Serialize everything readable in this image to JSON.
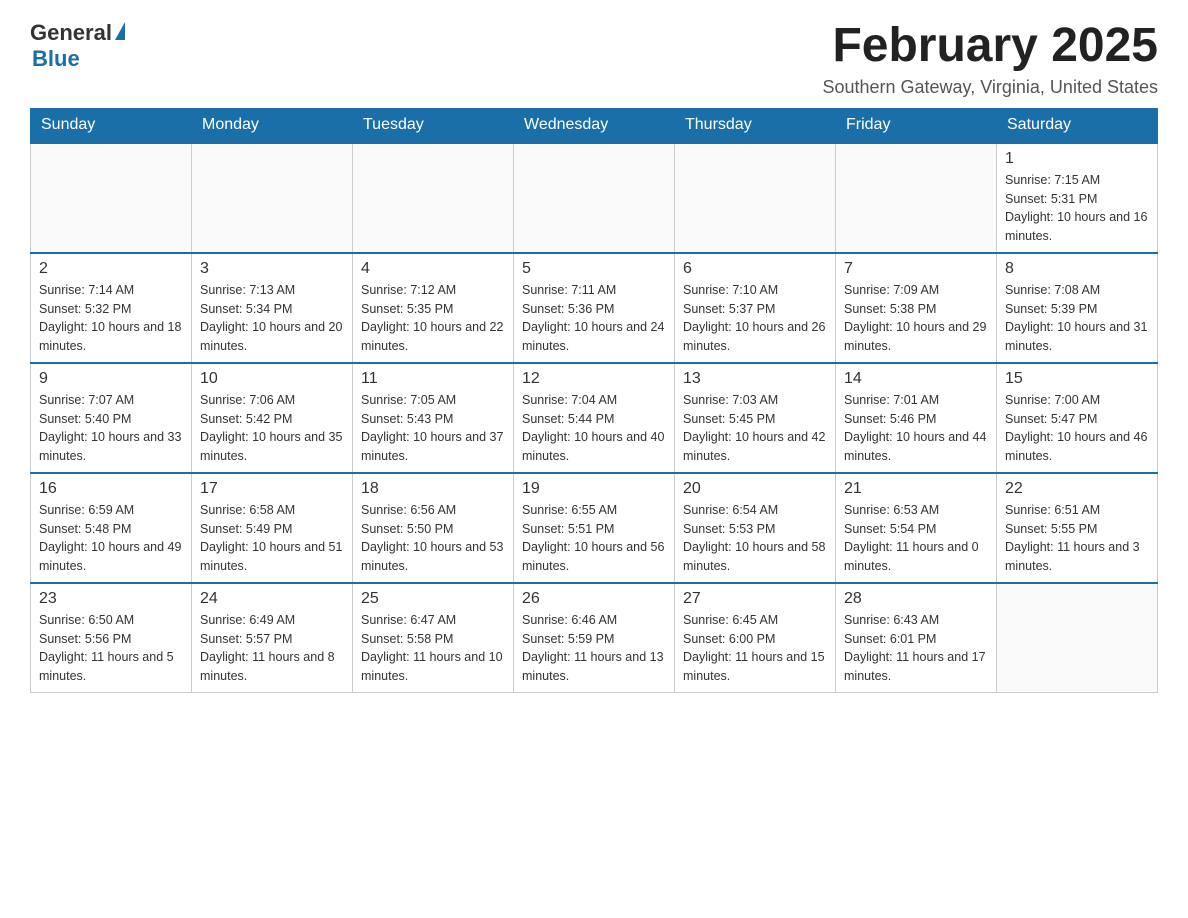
{
  "logo": {
    "general": "General",
    "blue": "Blue"
  },
  "title": "February 2025",
  "subtitle": "Southern Gateway, Virginia, United States",
  "days_of_week": [
    "Sunday",
    "Monday",
    "Tuesday",
    "Wednesday",
    "Thursday",
    "Friday",
    "Saturday"
  ],
  "weeks": [
    [
      {
        "day": "",
        "info": ""
      },
      {
        "day": "",
        "info": ""
      },
      {
        "day": "",
        "info": ""
      },
      {
        "day": "",
        "info": ""
      },
      {
        "day": "",
        "info": ""
      },
      {
        "day": "",
        "info": ""
      },
      {
        "day": "1",
        "info": "Sunrise: 7:15 AM\nSunset: 5:31 PM\nDaylight: 10 hours and 16 minutes."
      }
    ],
    [
      {
        "day": "2",
        "info": "Sunrise: 7:14 AM\nSunset: 5:32 PM\nDaylight: 10 hours and 18 minutes."
      },
      {
        "day": "3",
        "info": "Sunrise: 7:13 AM\nSunset: 5:34 PM\nDaylight: 10 hours and 20 minutes."
      },
      {
        "day": "4",
        "info": "Sunrise: 7:12 AM\nSunset: 5:35 PM\nDaylight: 10 hours and 22 minutes."
      },
      {
        "day": "5",
        "info": "Sunrise: 7:11 AM\nSunset: 5:36 PM\nDaylight: 10 hours and 24 minutes."
      },
      {
        "day": "6",
        "info": "Sunrise: 7:10 AM\nSunset: 5:37 PM\nDaylight: 10 hours and 26 minutes."
      },
      {
        "day": "7",
        "info": "Sunrise: 7:09 AM\nSunset: 5:38 PM\nDaylight: 10 hours and 29 minutes."
      },
      {
        "day": "8",
        "info": "Sunrise: 7:08 AM\nSunset: 5:39 PM\nDaylight: 10 hours and 31 minutes."
      }
    ],
    [
      {
        "day": "9",
        "info": "Sunrise: 7:07 AM\nSunset: 5:40 PM\nDaylight: 10 hours and 33 minutes."
      },
      {
        "day": "10",
        "info": "Sunrise: 7:06 AM\nSunset: 5:42 PM\nDaylight: 10 hours and 35 minutes."
      },
      {
        "day": "11",
        "info": "Sunrise: 7:05 AM\nSunset: 5:43 PM\nDaylight: 10 hours and 37 minutes."
      },
      {
        "day": "12",
        "info": "Sunrise: 7:04 AM\nSunset: 5:44 PM\nDaylight: 10 hours and 40 minutes."
      },
      {
        "day": "13",
        "info": "Sunrise: 7:03 AM\nSunset: 5:45 PM\nDaylight: 10 hours and 42 minutes."
      },
      {
        "day": "14",
        "info": "Sunrise: 7:01 AM\nSunset: 5:46 PM\nDaylight: 10 hours and 44 minutes."
      },
      {
        "day": "15",
        "info": "Sunrise: 7:00 AM\nSunset: 5:47 PM\nDaylight: 10 hours and 46 minutes."
      }
    ],
    [
      {
        "day": "16",
        "info": "Sunrise: 6:59 AM\nSunset: 5:48 PM\nDaylight: 10 hours and 49 minutes."
      },
      {
        "day": "17",
        "info": "Sunrise: 6:58 AM\nSunset: 5:49 PM\nDaylight: 10 hours and 51 minutes."
      },
      {
        "day": "18",
        "info": "Sunrise: 6:56 AM\nSunset: 5:50 PM\nDaylight: 10 hours and 53 minutes."
      },
      {
        "day": "19",
        "info": "Sunrise: 6:55 AM\nSunset: 5:51 PM\nDaylight: 10 hours and 56 minutes."
      },
      {
        "day": "20",
        "info": "Sunrise: 6:54 AM\nSunset: 5:53 PM\nDaylight: 10 hours and 58 minutes."
      },
      {
        "day": "21",
        "info": "Sunrise: 6:53 AM\nSunset: 5:54 PM\nDaylight: 11 hours and 0 minutes."
      },
      {
        "day": "22",
        "info": "Sunrise: 6:51 AM\nSunset: 5:55 PM\nDaylight: 11 hours and 3 minutes."
      }
    ],
    [
      {
        "day": "23",
        "info": "Sunrise: 6:50 AM\nSunset: 5:56 PM\nDaylight: 11 hours and 5 minutes."
      },
      {
        "day": "24",
        "info": "Sunrise: 6:49 AM\nSunset: 5:57 PM\nDaylight: 11 hours and 8 minutes."
      },
      {
        "day": "25",
        "info": "Sunrise: 6:47 AM\nSunset: 5:58 PM\nDaylight: 11 hours and 10 minutes."
      },
      {
        "day": "26",
        "info": "Sunrise: 6:46 AM\nSunset: 5:59 PM\nDaylight: 11 hours and 13 minutes."
      },
      {
        "day": "27",
        "info": "Sunrise: 6:45 AM\nSunset: 6:00 PM\nDaylight: 11 hours and 15 minutes."
      },
      {
        "day": "28",
        "info": "Sunrise: 6:43 AM\nSunset: 6:01 PM\nDaylight: 11 hours and 17 minutes."
      },
      {
        "day": "",
        "info": ""
      }
    ]
  ]
}
